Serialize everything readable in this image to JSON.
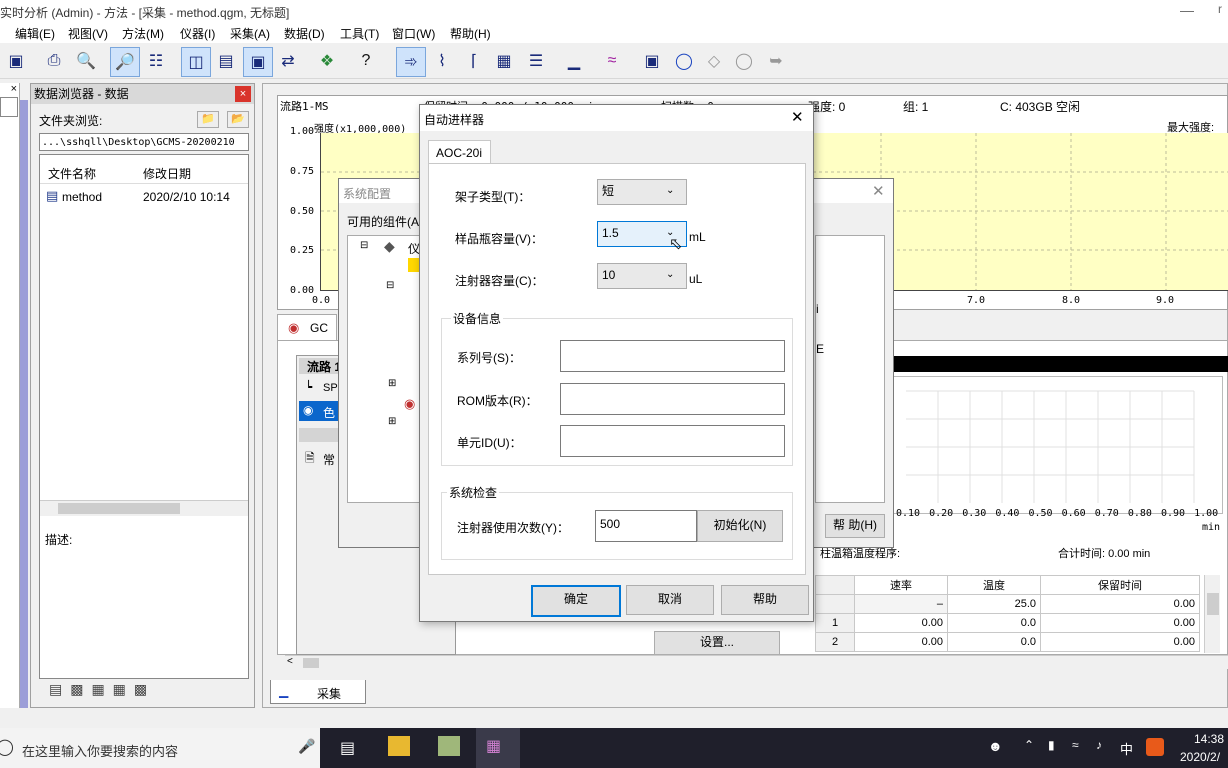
{
  "window": {
    "title": "实时分析 (Admin) - 方法 - [采集 - method.qgm, 无标题]",
    "right_glyph": "r"
  },
  "menu": [
    "编辑(E)",
    "视图(V)",
    "方法(M)",
    "仪器(I)",
    "采集(A)",
    "数据(D)",
    "工具(T)",
    "窗口(W)",
    "帮助(H)"
  ],
  "toolbar": {
    "icons": [
      "save-icon",
      "print-icon",
      "print-preview-icon",
      "data-search-icon",
      "data-compare-icon",
      "layout-1-icon",
      "layout-2-icon",
      "layout-3-icon",
      "nav-arrows-icon",
      "leaf-icon",
      "help-question-icon",
      "acquire-icon",
      "peak-1-icon",
      "peak-2-icon",
      "sequence-icon",
      "batch-icon",
      "bar-chart-icon",
      "spectrum-icon",
      "tune-icon",
      "cycle-icon",
      "diamond-icon",
      "stop-icon",
      "export-icon"
    ]
  },
  "data_browser": {
    "title": "数据浏览器 - 数据",
    "close": "×",
    "folder_label": "文件夹浏览:",
    "path": "...\\sshqll\\Desktop\\GCMS-20200210",
    "col_name": "文件名称",
    "col_date": "修改日期",
    "files": [
      {
        "name": "method",
        "date": "2020/2/10 10:14"
      }
    ],
    "desc_label": "描述:"
  },
  "chart_header": {
    "flow": "流路1-MS",
    "retention": "保留时间: 0.000 / 10.000 min",
    "scan": "扫描数: 0",
    "intensity": "强度: 0",
    "group": "组: 1",
    "c": "C:  403GB 空闲"
  },
  "chart_data": {
    "type": "line",
    "ylabel": "强度(x1,000,000)",
    "max_label": "最大强度:",
    "y_ticks": [
      "1.00",
      "0.75",
      "0.50",
      "0.25",
      "0.00"
    ],
    "x_ticks": [
      "0.0",
      "7.0",
      "8.0",
      "9.0"
    ],
    "series": []
  },
  "gc_tab": {
    "label": "GC"
  },
  "flow_table_header": "流路 1",
  "tree_items": [
    "SPL",
    "色"
  ],
  "cmd_item": "常",
  "setup_button": "设置...",
  "sys_config": {
    "title": "系统配置",
    "available": "可用的组件(A",
    "tree_root": "仪",
    "help_button": "帮 助(H)",
    "side_letters": [
      "i",
      "E"
    ]
  },
  "small_chart": {
    "x_ticks": [
      "0.10",
      "0.20",
      "0.30",
      "0.40",
      "0.50",
      "0.60",
      "0.70",
      "0.80",
      "0.90",
      "1.00"
    ],
    "x_unit": "min"
  },
  "temp_program": {
    "label": "柱温箱温度程序:",
    "total_time": "合计时间: 0.00 min",
    "columns": [
      "速率",
      "温度",
      "保留时间"
    ],
    "rows": [
      {
        "idx": "",
        "rate": "–",
        "temp": "25.0",
        "hold": "0.00"
      },
      {
        "idx": "1",
        "rate": "0.00",
        "temp": "0.0",
        "hold": "0.00"
      },
      {
        "idx": "2",
        "rate": "0.00",
        "temp": "0.0",
        "hold": "0.00"
      }
    ]
  },
  "bottom_tab": "采集",
  "autosampler": {
    "title": "自动进样器",
    "tab": "AOC-20i",
    "rack_label": "架子类型(T)：",
    "rack_value": "短",
    "vial_label": "样品瓶容量(V)：",
    "vial_value": "1.5",
    "vial_unit": "mL",
    "syringe_label": "注射器容量(C)：",
    "syringe_value": "10",
    "syringe_unit": "uL",
    "device_info": "设备信息",
    "serial_label": "系列号(S)：",
    "rom_label": "ROM版本(R)：",
    "unit_label": "单元ID(U)：",
    "serial_value": "",
    "rom_value": "",
    "unit_value": "",
    "sys_check": "系统检查",
    "usage_label": "注射器使用次数(Y)：",
    "usage_value": "500",
    "init_button": "初始化(N)",
    "ok": "确定",
    "cancel": "取消",
    "help": "帮助",
    "close": "✕"
  },
  "taskbar": {
    "search_placeholder": "在这里输入你要搜索的内容",
    "time": "14:38",
    "date": "2020/2/",
    "ime": "中"
  }
}
